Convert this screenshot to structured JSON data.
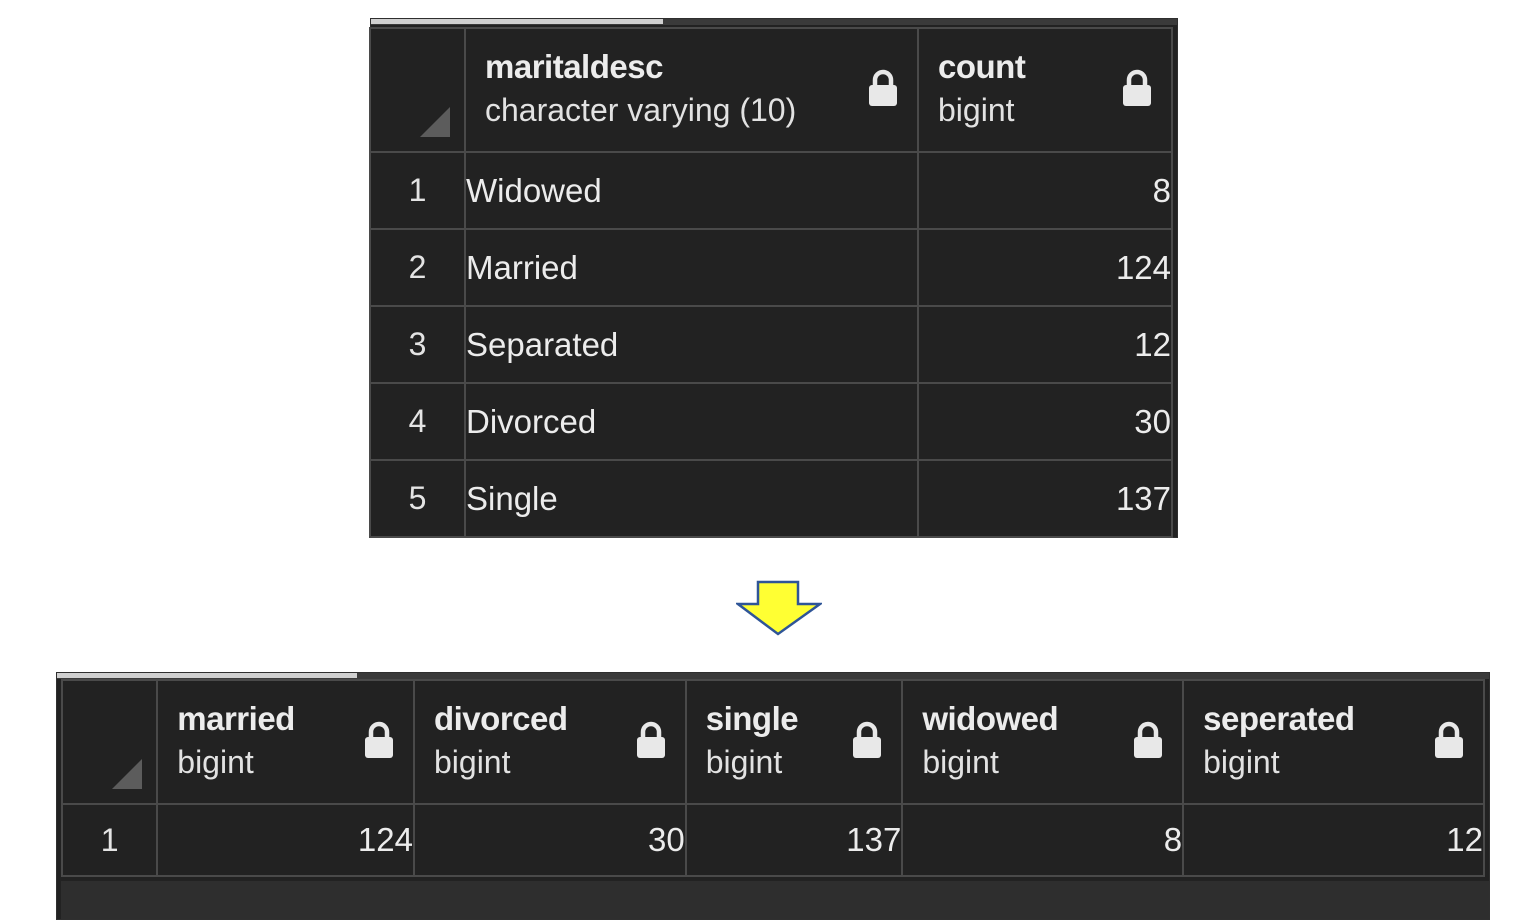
{
  "top_table": {
    "columns": [
      {
        "name": "maritaldesc",
        "type": "character varying (10)"
      },
      {
        "name": "count",
        "type": "bigint"
      }
    ],
    "rows": [
      {
        "row": "1",
        "maritaldesc": "Widowed",
        "count": "8"
      },
      {
        "row": "2",
        "maritaldesc": "Married",
        "count": "124"
      },
      {
        "row": "3",
        "maritaldesc": "Separated",
        "count": "12"
      },
      {
        "row": "4",
        "maritaldesc": "Divorced",
        "count": "30"
      },
      {
        "row": "5",
        "maritaldesc": "Single",
        "count": "137"
      }
    ]
  },
  "arrow": {
    "icon": "down-arrow-icon",
    "fill": "#ffff33",
    "stroke": "#2f5597"
  },
  "bottom_table": {
    "columns": [
      {
        "name": "married",
        "type": "bigint"
      },
      {
        "name": "divorced",
        "type": "bigint"
      },
      {
        "name": "single",
        "type": "bigint"
      },
      {
        "name": "widowed",
        "type": "bigint"
      },
      {
        "name": "seperated",
        "type": "bigint"
      }
    ],
    "rows": [
      {
        "row": "1",
        "values": [
          "124",
          "30",
          "137",
          "8",
          "12"
        ]
      }
    ]
  },
  "colors": {
    "grid_background": "#222222",
    "grid_lines": "#4a4a4a",
    "text": "#ececec"
  },
  "icons": {
    "column_lock": "lock-icon",
    "select_all": "select-all-corner-icon"
  }
}
